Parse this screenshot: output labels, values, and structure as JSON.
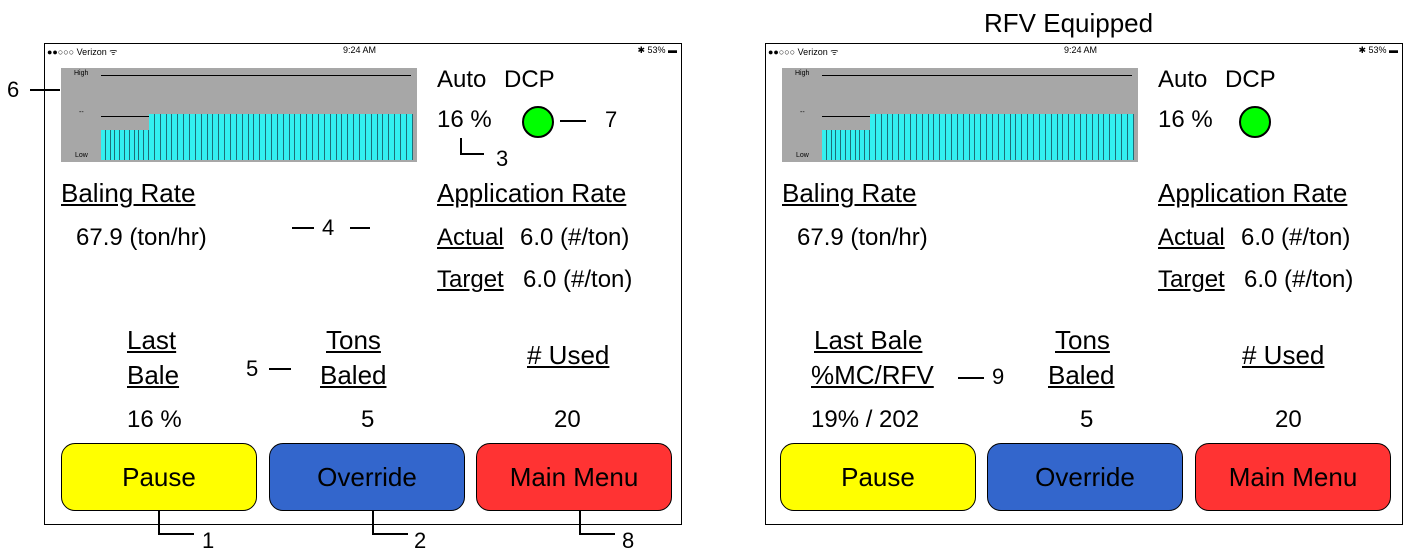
{
  "caption": "RFV Equipped",
  "status_bar": {
    "carrier": "●●○○○ Verizon ᯤ",
    "time": "9:24 AM",
    "battery": "✱ 53% ▬"
  },
  "graph": {
    "high": "High",
    "mid": "--",
    "low": "Low"
  },
  "mode": {
    "auto": "Auto",
    "dcp": "DCP",
    "percent": "16 %"
  },
  "baling_rate": {
    "label": "Baling Rate",
    "value": "67.9 (ton/hr)"
  },
  "application_rate": {
    "label": "Application Rate",
    "actual_label": "Actual",
    "actual_value": "6.0 (#/ton)",
    "target_label": "Target",
    "target_value": "6.0 (#/ton)"
  },
  "screen1_stats": {
    "last_bale_l1": "Last",
    "last_bale_l2": "Bale",
    "last_bale_value": "16 %",
    "tons_l1": "Tons",
    "tons_l2": "Baled",
    "tons_value": "5",
    "used_label": "# Used",
    "used_value": "20"
  },
  "screen2_stats": {
    "last_bale_l1": "Last Bale",
    "last_bale_l2": "%MC/RFV",
    "last_bale_value": "19% / 202",
    "tons_l1": "Tons",
    "tons_l2": "Baled",
    "tons_value": "5",
    "used_label": "# Used",
    "used_value": "20"
  },
  "buttons": {
    "pause": "Pause",
    "override": "Override",
    "main_menu": "Main Menu"
  },
  "button_colors": {
    "pause": "#ffff00",
    "override": "#3366cc",
    "main_menu": "#ff3333"
  },
  "indicator_color": "#00ff00",
  "callouts": {
    "c1": "1",
    "c2": "2",
    "c3": "3",
    "c4": "4",
    "c5": "5",
    "c6": "6",
    "c7": "7",
    "c8": "8",
    "c9": "9"
  }
}
